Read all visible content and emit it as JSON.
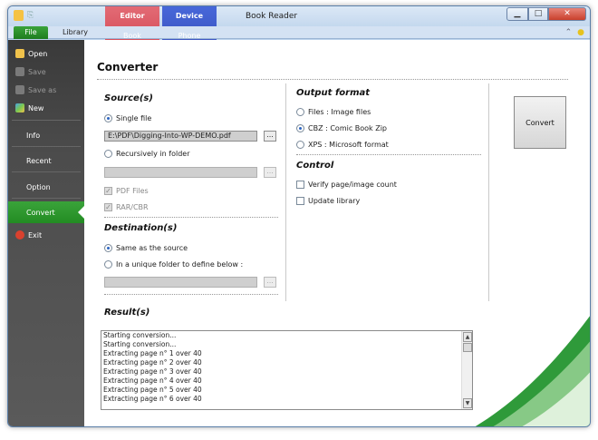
{
  "window": {
    "title": "Book Reader"
  },
  "context_tabs": {
    "editor": {
      "title": "Editor",
      "tab": "Book"
    },
    "device": {
      "title": "Device",
      "tab": "Phone"
    }
  },
  "ribbon": {
    "file": "File",
    "library": "Library"
  },
  "sidebar": {
    "items": [
      {
        "label": "Open",
        "enabled": true
      },
      {
        "label": "Save",
        "enabled": false
      },
      {
        "label": "Save as",
        "enabled": false
      },
      {
        "label": "New",
        "enabled": true
      },
      {
        "label": "Info"
      },
      {
        "label": "Recent"
      },
      {
        "label": "Option"
      },
      {
        "label": "Convert",
        "active": true
      },
      {
        "label": "Exit"
      }
    ]
  },
  "converter": {
    "title": "Converter",
    "source": {
      "title": "Source(s)",
      "single_file": "Single file",
      "path": "E:\\PDF\\Digging-Into-WP-DEMO.pdf",
      "recursive": "Recursively in folder",
      "pdf_files": "PDF Files",
      "rar_cbr": "RAR/CBR"
    },
    "destination": {
      "title": "Destination(s)",
      "same": "Same as the source",
      "unique": "In a unique folder to define below :"
    },
    "output": {
      "title": "Output format",
      "files": "Files : Image files",
      "cbz": "CBZ : Comic Book Zip",
      "xps": "XPS : Microsoft format",
      "selected": "CBZ : Comic Book Zip"
    },
    "control": {
      "title": "Control",
      "verify": "Verify page/image count",
      "update": "Update library"
    },
    "convert_button": "Convert",
    "browse_label": "...",
    "result": {
      "title": "Result(s)",
      "lines": [
        "Starting conversion...",
        "Starting conversion...",
        "Extracting page n° 1 over 40",
        "Extracting page n° 2 over 40",
        "Extracting page n° 3 over 40",
        "Extracting page n° 4 over 40",
        "Extracting page n° 5 over 40",
        "Extracting page n° 6 over 40"
      ]
    }
  },
  "colors": {
    "accent_green": "#2e9a2e",
    "editor_tab": "#d95461",
    "device_tab": "#3d5ad0"
  }
}
